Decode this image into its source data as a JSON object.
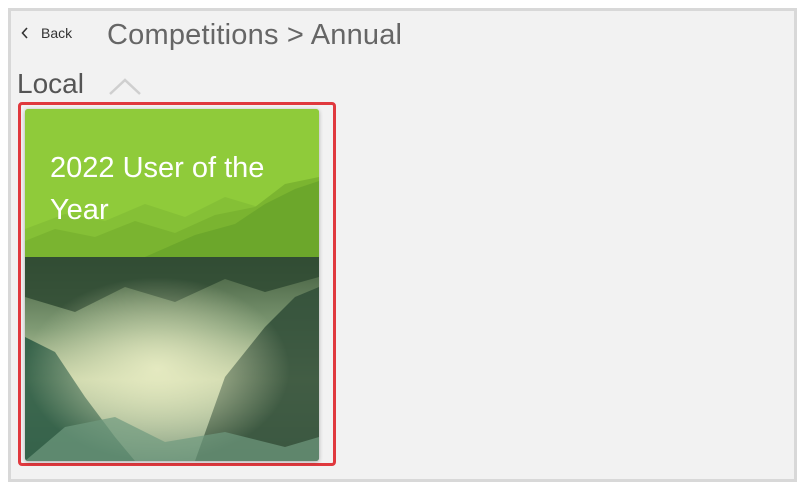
{
  "header": {
    "back_label": "Back",
    "title": "Competitions > Annual"
  },
  "section": {
    "title": "Local"
  },
  "cards": [
    {
      "title": "2022 User of the Year"
    }
  ],
  "colors": {
    "background": "#f2f2f2",
    "card_header": "#8bc34a",
    "highlight": "#e0393e"
  },
  "icons": {
    "back": "chevron-left-icon",
    "collapse": "chevron-up-icon"
  }
}
